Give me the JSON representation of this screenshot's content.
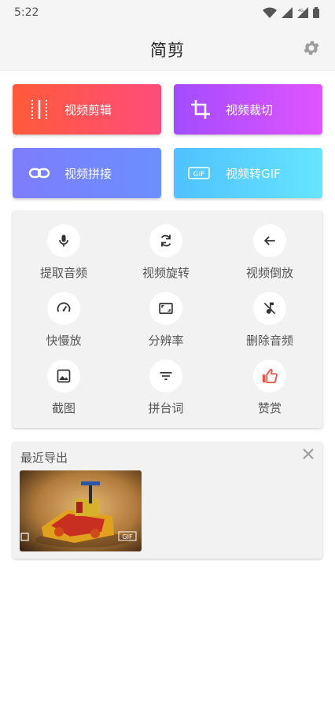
{
  "status_bar": {
    "time": "5:22",
    "icons": [
      "wifi-icon",
      "signal-icon",
      "signal-4g-icon",
      "battery-icon"
    ]
  },
  "app_bar": {
    "title": "简剪",
    "settings_icon": "gear-icon"
  },
  "main_actions": [
    {
      "label": "视频剪辑",
      "icon": "film-strip-icon",
      "gradient": [
        "#ff5a3a",
        "#ff4d7a"
      ]
    },
    {
      "label": "视频裁切",
      "icon": "crop-icon",
      "gradient": [
        "#a24cff",
        "#e054ff"
      ]
    },
    {
      "label": "视频拼接",
      "icon": "link-icon",
      "gradient": [
        "#7d7dfc",
        "#6b8fff"
      ]
    },
    {
      "label": "视频转GIF",
      "icon": "gif-icon",
      "gradient": [
        "#4fc1ff",
        "#66e4ff"
      ]
    }
  ],
  "tools": [
    {
      "label": "提取音频",
      "icon": "mic-icon"
    },
    {
      "label": "视频旋转",
      "icon": "rotate-icon"
    },
    {
      "label": "视频倒放",
      "icon": "arrow-left-icon"
    },
    {
      "label": "快慢放",
      "icon": "speedometer-icon"
    },
    {
      "label": "分辨率",
      "icon": "aspect-ratio-icon"
    },
    {
      "label": "删除音频",
      "icon": "music-off-icon"
    },
    {
      "label": "截图",
      "icon": "image-icon"
    },
    {
      "label": "拼台词",
      "icon": "filter-lines-icon"
    },
    {
      "label": "赞赏",
      "icon": "thumbs-up-icon",
      "color": "#f0524a"
    }
  ],
  "recent": {
    "title": "最近导出",
    "close_icon": "close-icon",
    "items": [
      {
        "type_badge": "GIF",
        "corner_icon": "video-icon"
      }
    ]
  }
}
